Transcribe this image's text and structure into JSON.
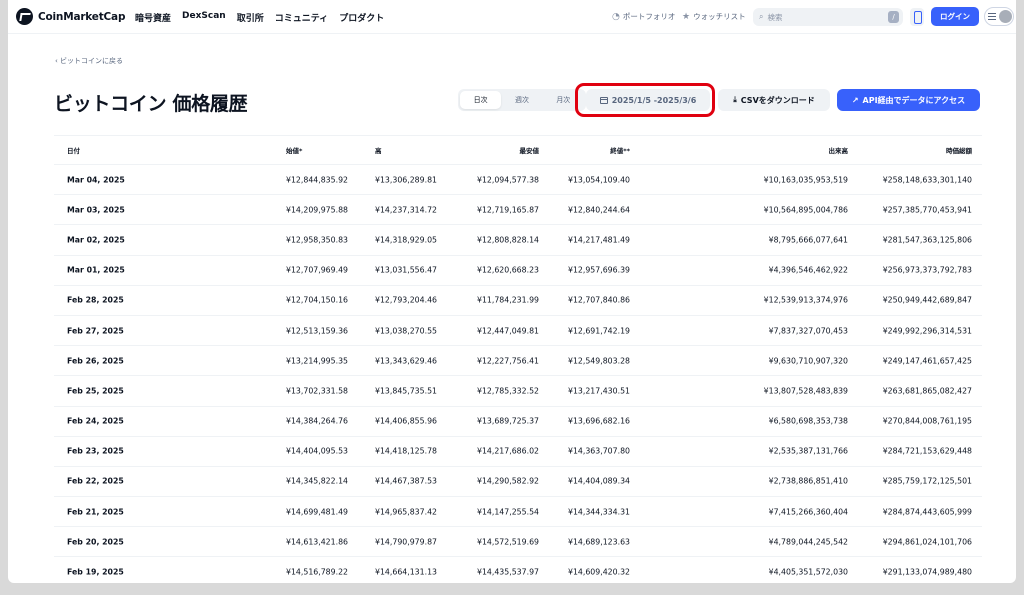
{
  "header": {
    "logo_text": "CoinMarketCap",
    "nav": [
      "暗号資産",
      "DexScan",
      "取引所",
      "コミュニティ",
      "プロダクト"
    ],
    "portfolio": "ポートフォリオ",
    "watchlist": "ウォッチリスト",
    "search_placeholder": "検索",
    "search_shortcut": "/",
    "login": "ログイン"
  },
  "back_link": "‹ ビットコインに戻る",
  "title": "ビットコイン 価格履歴",
  "interval_tabs": [
    {
      "label": "日次",
      "active": true
    },
    {
      "label": "週次",
      "active": false
    },
    {
      "label": "月次",
      "active": false
    }
  ],
  "date_range": "2025/1/5 -2025/3/6",
  "csv_label": "CSVをダウンロード",
  "api_label": "API経由でデータにアクセス",
  "accent_color": "#3861fb",
  "highlight_color": "#e0000f",
  "table": {
    "columns": [
      "日付",
      "始値*",
      "高",
      "最安値",
      "終値**",
      "出来高",
      "時価総額"
    ],
    "rows": [
      [
        "Mar 04, 2025",
        "¥12,844,835.92",
        "¥13,306,289.81",
        "¥12,094,577.38",
        "¥13,054,109.40",
        "¥10,163,035,953,519",
        "¥258,148,633,301,140"
      ],
      [
        "Mar 03, 2025",
        "¥14,209,975.88",
        "¥14,237,314.72",
        "¥12,719,165.87",
        "¥12,840,244.64",
        "¥10,564,895,004,786",
        "¥257,385,770,453,941"
      ],
      [
        "Mar 02, 2025",
        "¥12,958,350.83",
        "¥14,318,929.05",
        "¥12,808,828.14",
        "¥14,217,481.49",
        "¥8,795,666,077,641",
        "¥281,547,363,125,806"
      ],
      [
        "Mar 01, 2025",
        "¥12,707,969.49",
        "¥13,031,556.47",
        "¥12,620,668.23",
        "¥12,957,696.39",
        "¥4,396,546,462,922",
        "¥256,973,373,792,783"
      ],
      [
        "Feb 28, 2025",
        "¥12,704,150.16",
        "¥12,793,204.46",
        "¥11,784,231.99",
        "¥12,707,840.86",
        "¥12,539,913,374,976",
        "¥250,949,442,689,847"
      ],
      [
        "Feb 27, 2025",
        "¥12,513,159.36",
        "¥13,038,270.55",
        "¥12,447,049.81",
        "¥12,691,742.19",
        "¥7,837,327,070,453",
        "¥249,992,296,314,531"
      ],
      [
        "Feb 26, 2025",
        "¥13,214,995.35",
        "¥13,343,629.46",
        "¥12,227,756.41",
        "¥12,549,803.28",
        "¥9,630,710,907,320",
        "¥249,147,461,657,425"
      ],
      [
        "Feb 25, 2025",
        "¥13,702,331.58",
        "¥13,845,735.51",
        "¥12,785,332.52",
        "¥13,217,430.51",
        "¥13,807,528,483,839",
        "¥263,681,865,082,427"
      ],
      [
        "Feb 24, 2025",
        "¥14,384,264.76",
        "¥14,406,855.96",
        "¥13,689,725.37",
        "¥13,696,682.16",
        "¥6,580,698,353,738",
        "¥270,844,008,761,195"
      ],
      [
        "Feb 23, 2025",
        "¥14,404,095.53",
        "¥14,418,125.78",
        "¥14,217,686.02",
        "¥14,363,707.80",
        "¥2,535,387,131,766",
        "¥284,721,153,629,448"
      ],
      [
        "Feb 22, 2025",
        "¥14,345,822.14",
        "¥14,467,387.53",
        "¥14,290,582.92",
        "¥14,404,089.34",
        "¥2,738,886,851,410",
        "¥285,759,172,125,501"
      ],
      [
        "Feb 21, 2025",
        "¥14,699,481.49",
        "¥14,965,837.42",
        "¥14,147,255.54",
        "¥14,344,334.31",
        "¥7,415,266,360,404",
        "¥284,874,443,605,999"
      ],
      [
        "Feb 20, 2025",
        "¥14,613,421.86",
        "¥14,790,979.87",
        "¥14,572,519.69",
        "¥14,689,123.63",
        "¥4,789,044,245,542",
        "¥294,861,024,101,706"
      ],
      [
        "Feb 19, 2025",
        "¥14,516,789.22",
        "¥14,664,131.13",
        "¥14,435,537.97",
        "¥14,609,420.32",
        "¥4,405,351,572,030",
        "¥291,133,074,989,480"
      ]
    ]
  }
}
